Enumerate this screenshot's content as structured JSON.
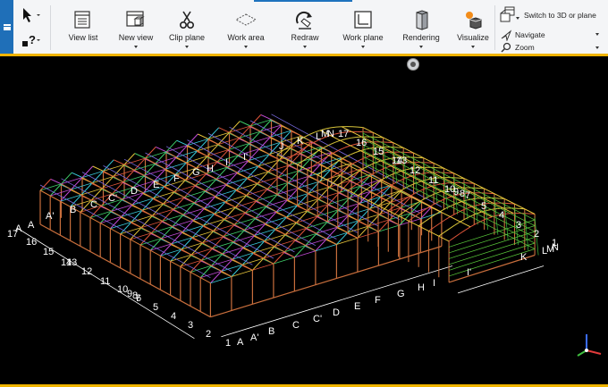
{
  "toolbar": {
    "items": [
      {
        "label": "View list",
        "has_menu": false,
        "icon": "view-list-icon"
      },
      {
        "label": "New view",
        "has_menu": true,
        "icon": "new-view-icon"
      },
      {
        "label": "Clip plane",
        "has_menu": true,
        "icon": "scissors-icon"
      },
      {
        "label": "Work area",
        "has_menu": true,
        "icon": "work-area-icon"
      },
      {
        "label": "Redraw",
        "has_menu": true,
        "icon": "redraw-icon"
      },
      {
        "label": "Work plane",
        "has_menu": true,
        "icon": "work-plane-icon"
      },
      {
        "label": "Rendering",
        "has_menu": true,
        "icon": "rendering-icon"
      },
      {
        "label": "Visualize",
        "has_menu": true,
        "icon": "visualize-icon"
      }
    ],
    "side": {
      "switch": "Switch to 3D or plane",
      "navigate": "Navigate",
      "zoom": "Zoom"
    },
    "small_tools": {
      "select": "select-pointer-icon",
      "help": "help-pointer-icon"
    }
  },
  "grid_labels_left_building": {
    "top_axes": [
      "A",
      "A'",
      "B",
      "C",
      "C'",
      "D",
      "E",
      "F",
      "G",
      "H",
      "I",
      "I'"
    ],
    "left_axes": [
      "17",
      "A",
      "16",
      "15",
      "14",
      "13",
      "12",
      "11",
      "10",
      "9",
      "8",
      "7",
      "6",
      "5",
      "4",
      "3",
      "2",
      "1"
    ],
    "bottom_axes": [
      "A",
      "A'",
      "B",
      "C",
      "C'",
      "D",
      "E",
      "F",
      "G",
      "H",
      "I",
      "I'"
    ]
  },
  "grid_labels_right_building": {
    "top_axes": [
      "J",
      "K",
      "L",
      "M",
      "N",
      "17",
      "16",
      "15",
      "14",
      "13",
      "12",
      "11",
      "10",
      "9",
      "8",
      "7",
      "5",
      "4",
      "3",
      "2",
      "1"
    ],
    "bottom_axes": [
      "K",
      "L",
      "M",
      "N"
    ]
  },
  "viewport": {
    "background": "#000000",
    "axis_triad": [
      "x-axis",
      "y-axis",
      "z-axis"
    ]
  },
  "colors": {
    "accent_blue": "#1e73be",
    "ribbon_border": "#f0b400",
    "ribbon_bg": "#f4f5f7"
  }
}
